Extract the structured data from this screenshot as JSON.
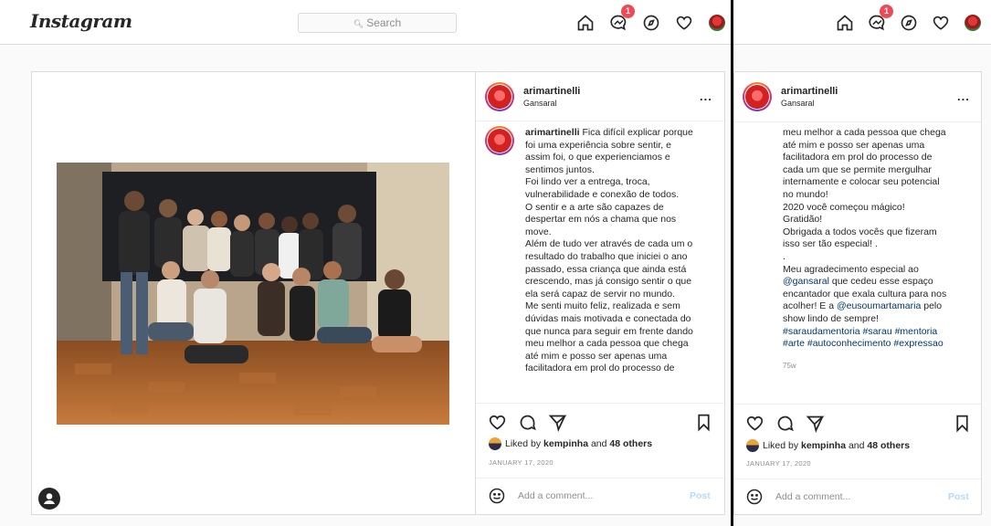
{
  "nav": {
    "logo": "Instagram",
    "search_placeholder": "Search",
    "notification_count": "1"
  },
  "post": {
    "username": "arimartinelli",
    "location": "Gansaral",
    "more": "...",
    "caption_lines_left": [
      "Fica difícil explicar porque",
      "foi uma experiência sobre sentir, e",
      "assim foi, o que experienciamos e",
      "sentimos juntos.",
      "Foi lindo ver a entrega, troca,",
      "vulnerabilidade e conexão de todos.",
      "O sentir e a arte são capazes de",
      "despertar em nós a chama que nos",
      "move.",
      "Além de tudo ver através de cada um o",
      "resultado do trabalho que iniciei o ano",
      "passado, essa criança que ainda está",
      "crescendo, mas já consigo sentir o que",
      "ela será capaz de servir no mundo.",
      "Me senti muito feliz, realizada e sem",
      "dúvidas mais motivada e conectada do",
      "que nunca para seguir em frente dando",
      "meu melhor a cada pessoa que chega",
      "até mim e posso ser apenas uma",
      "facilitadora em prol do processo de"
    ],
    "caption_lines_right": [
      "meu melhor a cada pessoa que chega",
      "até mim e posso ser apenas uma",
      "facilitadora em prol do processo de",
      "cada um que se permite mergulhar",
      "internamente e colocar seu potencial",
      "no mundo!",
      "2020 você começou mágico!",
      "Gratidão!",
      "Obrigada a todos vocês que fizeram",
      "isso ser tão especial! .",
      "."
    ],
    "thanks_line": "Meu agradecimento especial ao",
    "mention1": "@gansaral",
    "after_mention1": " que cedeu esse espaço",
    "line_encantador": "encantador que exala cultura para nos",
    "acolher_pre": "acolher! E a ",
    "mention2": "@eusoumartamaria",
    "after_mention2": " pelo",
    "line_show": "show lindo de sempre!",
    "hashtags1": "#saraudamentoria #sarau #mentoria",
    "hashtags2": "#arte #autoconhecimento #expressao",
    "time_ago": "75w",
    "liked_prefix": "Liked by ",
    "liked_user": "kempinha",
    "liked_and": " and ",
    "liked_others": "48 others",
    "date": "JANUARY 17, 2020",
    "comment_placeholder": "Add a comment...",
    "post_button": "Post"
  },
  "colors": {
    "link": "#00376b",
    "post_button_disabled": "#b3dbff",
    "badge": "#ed4956"
  }
}
